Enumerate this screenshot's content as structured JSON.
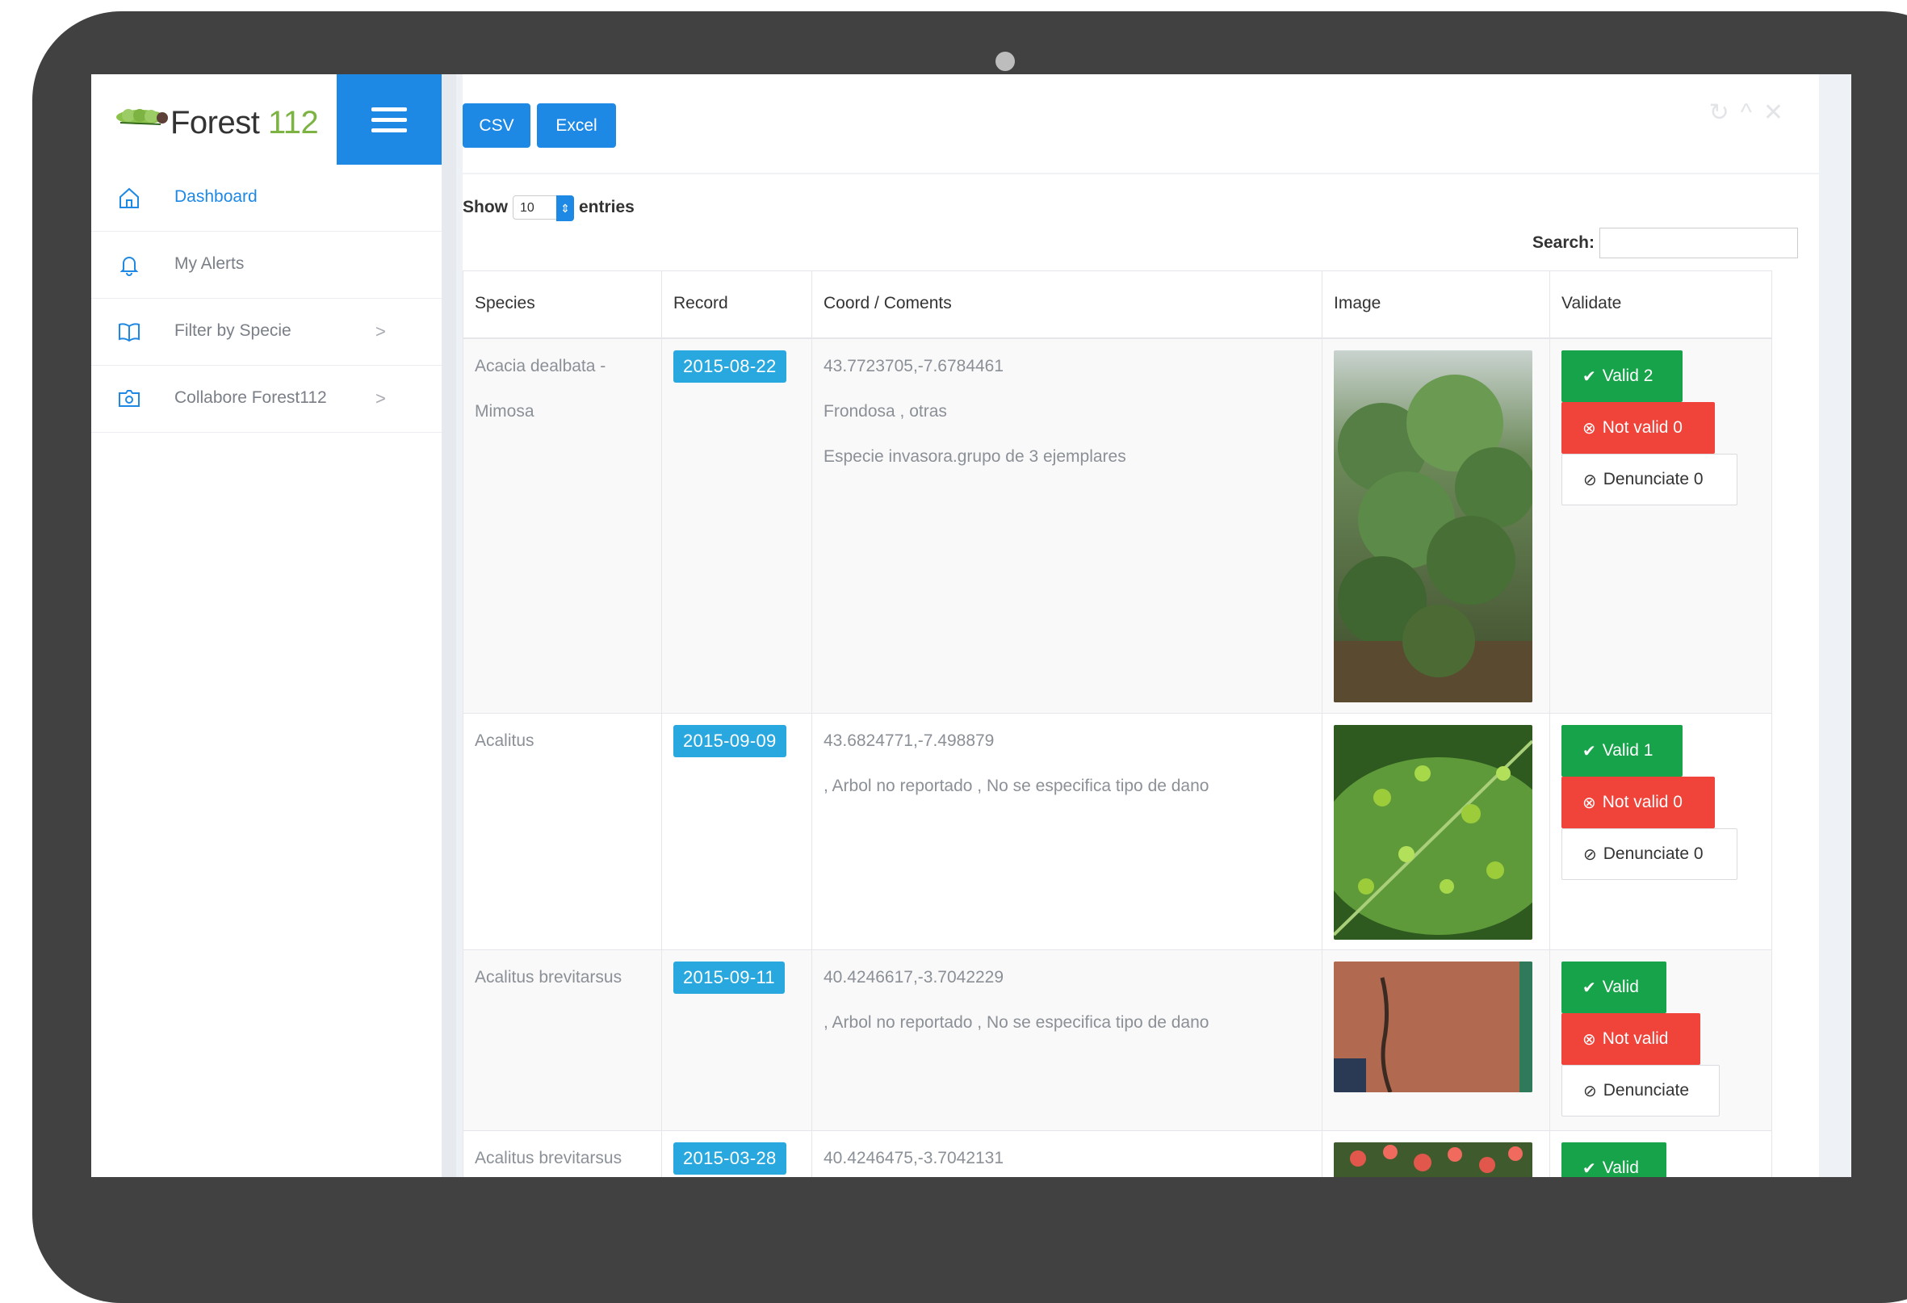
{
  "app": {
    "logo_word": "Forest",
    "logo_number": "112"
  },
  "sidebar": {
    "items": [
      {
        "label": "Dashboard",
        "icon": "home-icon",
        "active": true
      },
      {
        "label": "My Alerts",
        "icon": "bell-icon",
        "active": false
      },
      {
        "label": "Filter by Specie",
        "icon": "book-icon",
        "active": false,
        "chevron": ">"
      },
      {
        "label": "Collabore Forest112",
        "icon": "camera-folder-icon",
        "active": false,
        "chevron": ">"
      }
    ]
  },
  "toolbar": {
    "csv_label": "CSV",
    "excel_label": "Excel"
  },
  "table_controls": {
    "show_label": "Show",
    "entries_value": "10",
    "entries_label": "entries",
    "search_label": "Search:",
    "search_value": ""
  },
  "table": {
    "headers": [
      "Species",
      "Record",
      "Coord / Coments",
      "Image",
      "Validate"
    ],
    "rows": [
      {
        "species": "Acacia dealbata - Mimosa",
        "date": "2015-08-22",
        "coord": "43.7723705,-7.6784461",
        "comment1": "Frondosa , otras",
        "comment2": "Especie invasora.grupo de 3 ejemplares",
        "image": "shrub-photo",
        "valid": "Valid 2",
        "not_valid": "Not valid 0",
        "denunciate": "Denunciate 0"
      },
      {
        "species": "Acalitus",
        "date": "2015-09-09",
        "coord": "43.6824771,-7.498879",
        "comment1": ", Arbol no reportado , No se especifica tipo de dano",
        "comment2": "",
        "image": "leaf-galls-photo",
        "valid": "Valid 1",
        "not_valid": "Not valid 0",
        "denunciate": "Denunciate 0"
      },
      {
        "species": "Acalitus brevitarsus",
        "date": "2015-09-11",
        "coord": "40.4246617,-3.7042229",
        "comment1": ", Arbol no reportado , No se especifica tipo de dano",
        "comment2": "",
        "image": "bark-photo",
        "valid": "Valid",
        "not_valid": "Not valid",
        "denunciate": "Denunciate"
      },
      {
        "species": "Acalitus brevitarsus",
        "date": "2015-03-28",
        "coord": "40.4246475,-3.7042131",
        "comment1": "",
        "comment2": "",
        "image": "red-galls-photo",
        "valid": "Valid",
        "not_valid": "",
        "denunciate": ""
      }
    ]
  },
  "colors": {
    "accent": "#1e88e5",
    "date_badge": "#29a8df",
    "valid": "#17a34a",
    "not_valid": "#f0433a",
    "frame": "#414141"
  }
}
